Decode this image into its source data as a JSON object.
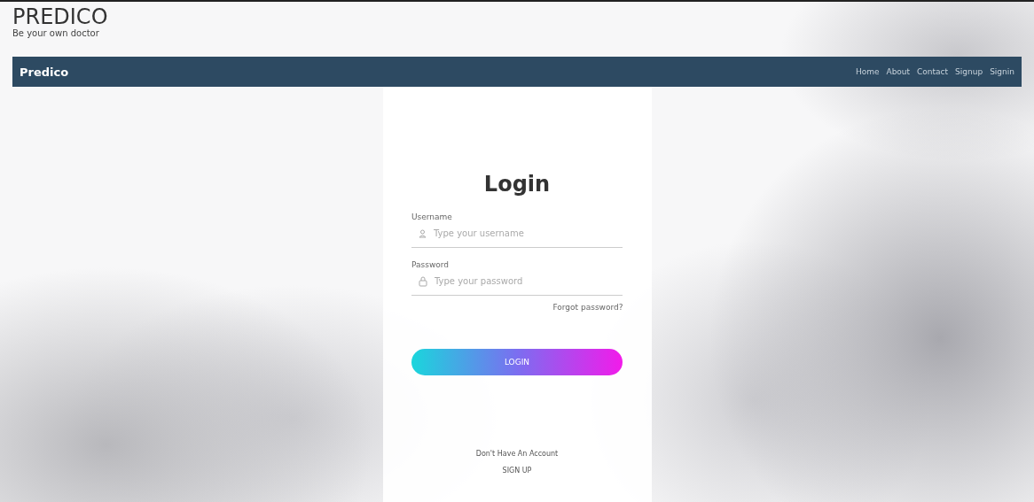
{
  "header": {
    "logo": "PREDICO",
    "tagline": "Be your own doctor"
  },
  "navbar": {
    "brand": "Predico",
    "links": [
      "Home",
      "About",
      "Contact",
      "Signup",
      "Signin"
    ]
  },
  "login": {
    "title": "Login",
    "fields": [
      {
        "label": "Username",
        "placeholder": "Type your username",
        "kind": "user"
      },
      {
        "label": "Password",
        "placeholder": "Type your password",
        "kind": "password"
      }
    ],
    "forgot": "Forgot password?",
    "button": "LOGIN",
    "no_account": "Don't Have An Account",
    "signup": "SIGN UP"
  }
}
